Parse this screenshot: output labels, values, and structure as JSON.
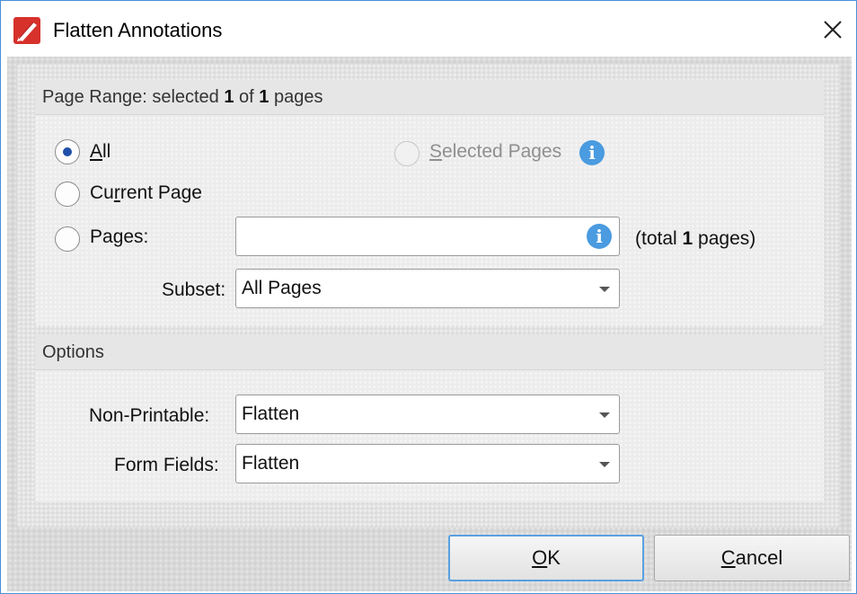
{
  "window": {
    "title": "Flatten Annotations"
  },
  "page_range": {
    "header_prefix": "Page Range: selected ",
    "selected": "1",
    "of_text": " of ",
    "total": "1",
    "suffix": " pages",
    "options": {
      "all": {
        "pre": "",
        "key": "A",
        "post": "ll",
        "checked": true
      },
      "selected_pages": {
        "pre": "",
        "key": "S",
        "post": "elected Pages",
        "checked": false,
        "disabled": true
      },
      "current_page": {
        "pre": "Cu",
        "key": "r",
        "post": "rent Page",
        "checked": false
      },
      "pages": {
        "pre": "Pa",
        "key": "g",
        "post": "es:",
        "checked": false
      }
    },
    "pages_input_value": "",
    "total_prefix": "(total ",
    "total_count": "1",
    "total_suffix": " pages)",
    "subset_label": "Subset:",
    "subset_value": "All Pages"
  },
  "options": {
    "header": "Options",
    "non_printable_label": "Non-Printable:",
    "non_printable_value": "Flatten",
    "form_fields_label": "Form Fields:",
    "form_fields_value": "Flatten"
  },
  "buttons": {
    "ok": {
      "key": "O",
      "post": "K"
    },
    "cancel": {
      "key": "C",
      "post": "ancel"
    }
  },
  "colors": {
    "accent": "#1f4fa8",
    "info": "#4a9be0",
    "app_icon": "#d6312b"
  }
}
